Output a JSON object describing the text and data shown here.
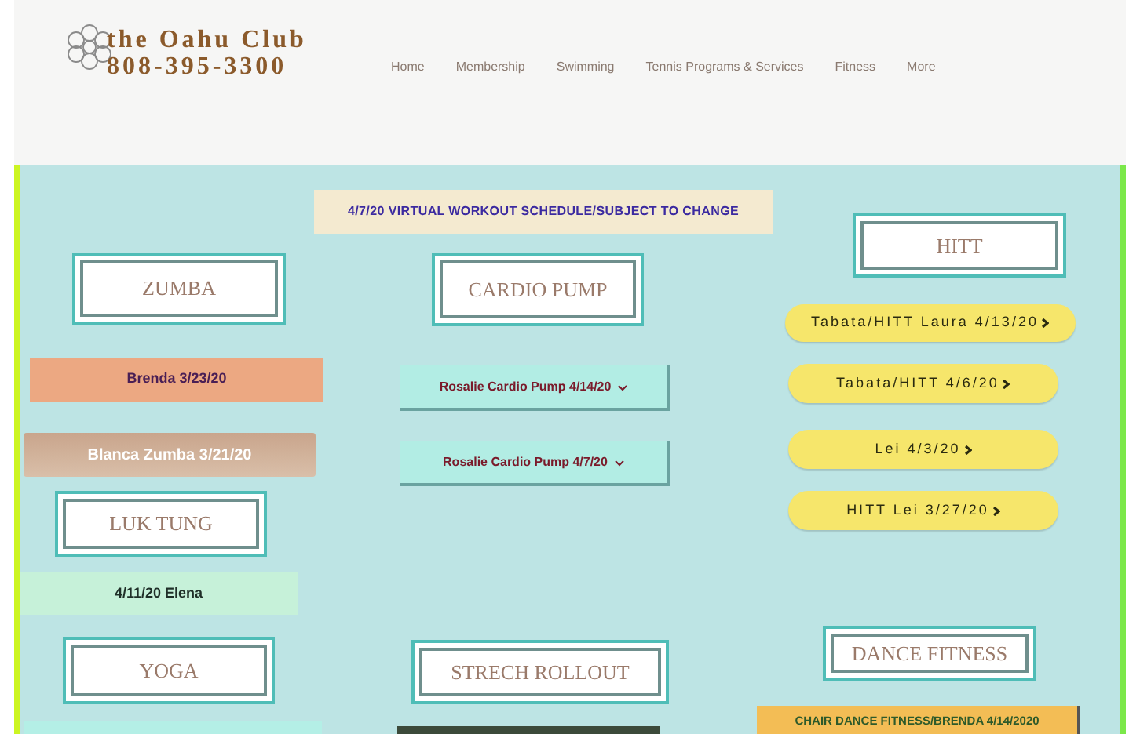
{
  "header": {
    "logo_title": "the Oahu Club",
    "phone": "808-395-3300",
    "nav": [
      {
        "label": "Home"
      },
      {
        "label": "Membership"
      },
      {
        "label": "Swimming"
      },
      {
        "label": "Tennis Programs & Services"
      },
      {
        "label": "Fitness"
      },
      {
        "label": "More"
      }
    ]
  },
  "items": [
    {
      "kind": "banner",
      "label": "4/7/20 VIRTUAL WORKOUT SCHEDULE/SUBJECT TO CHANGE"
    },
    {
      "kind": "heading",
      "label": "ZUMBA"
    },
    {
      "kind": "heading",
      "label": "CARDIO PUMP"
    },
    {
      "kind": "heading",
      "label": "HITT"
    },
    {
      "kind": "peach",
      "label": "Brenda 3/23/20"
    },
    {
      "kind": "tan",
      "label": "Blanca Zumba 3/21/20"
    },
    {
      "kind": "heading",
      "label": "LUK TUNG"
    },
    {
      "kind": "mint",
      "label": "4/11/20 Elena"
    },
    {
      "kind": "heading",
      "label": "YOGA"
    },
    {
      "kind": "heading",
      "label": "STRECH ROLLOUT"
    },
    {
      "kind": "heading",
      "label": "DANCE FITNESS"
    },
    {
      "kind": "dropdown",
      "label": "Rosalie Cardio Pump 4/14/20"
    },
    {
      "kind": "dropdown",
      "label": "Rosalie Cardio Pump 4/7/20"
    },
    {
      "kind": "pill",
      "label": "Tabata/HITT Laura 4/13/20"
    },
    {
      "kind": "pill",
      "label": "Tabata/HITT 4/6/20"
    },
    {
      "kind": "pill",
      "label": "Lei 4/3/20"
    },
    {
      "kind": "pill",
      "label": "HITT Lei 3/27/20"
    },
    {
      "kind": "orange",
      "label": "CHAIR DANCE FITNESS/BRENDA 4/14/2020"
    },
    {
      "kind": "cut_mint"
    },
    {
      "kind": "cut_dark"
    }
  ]
}
